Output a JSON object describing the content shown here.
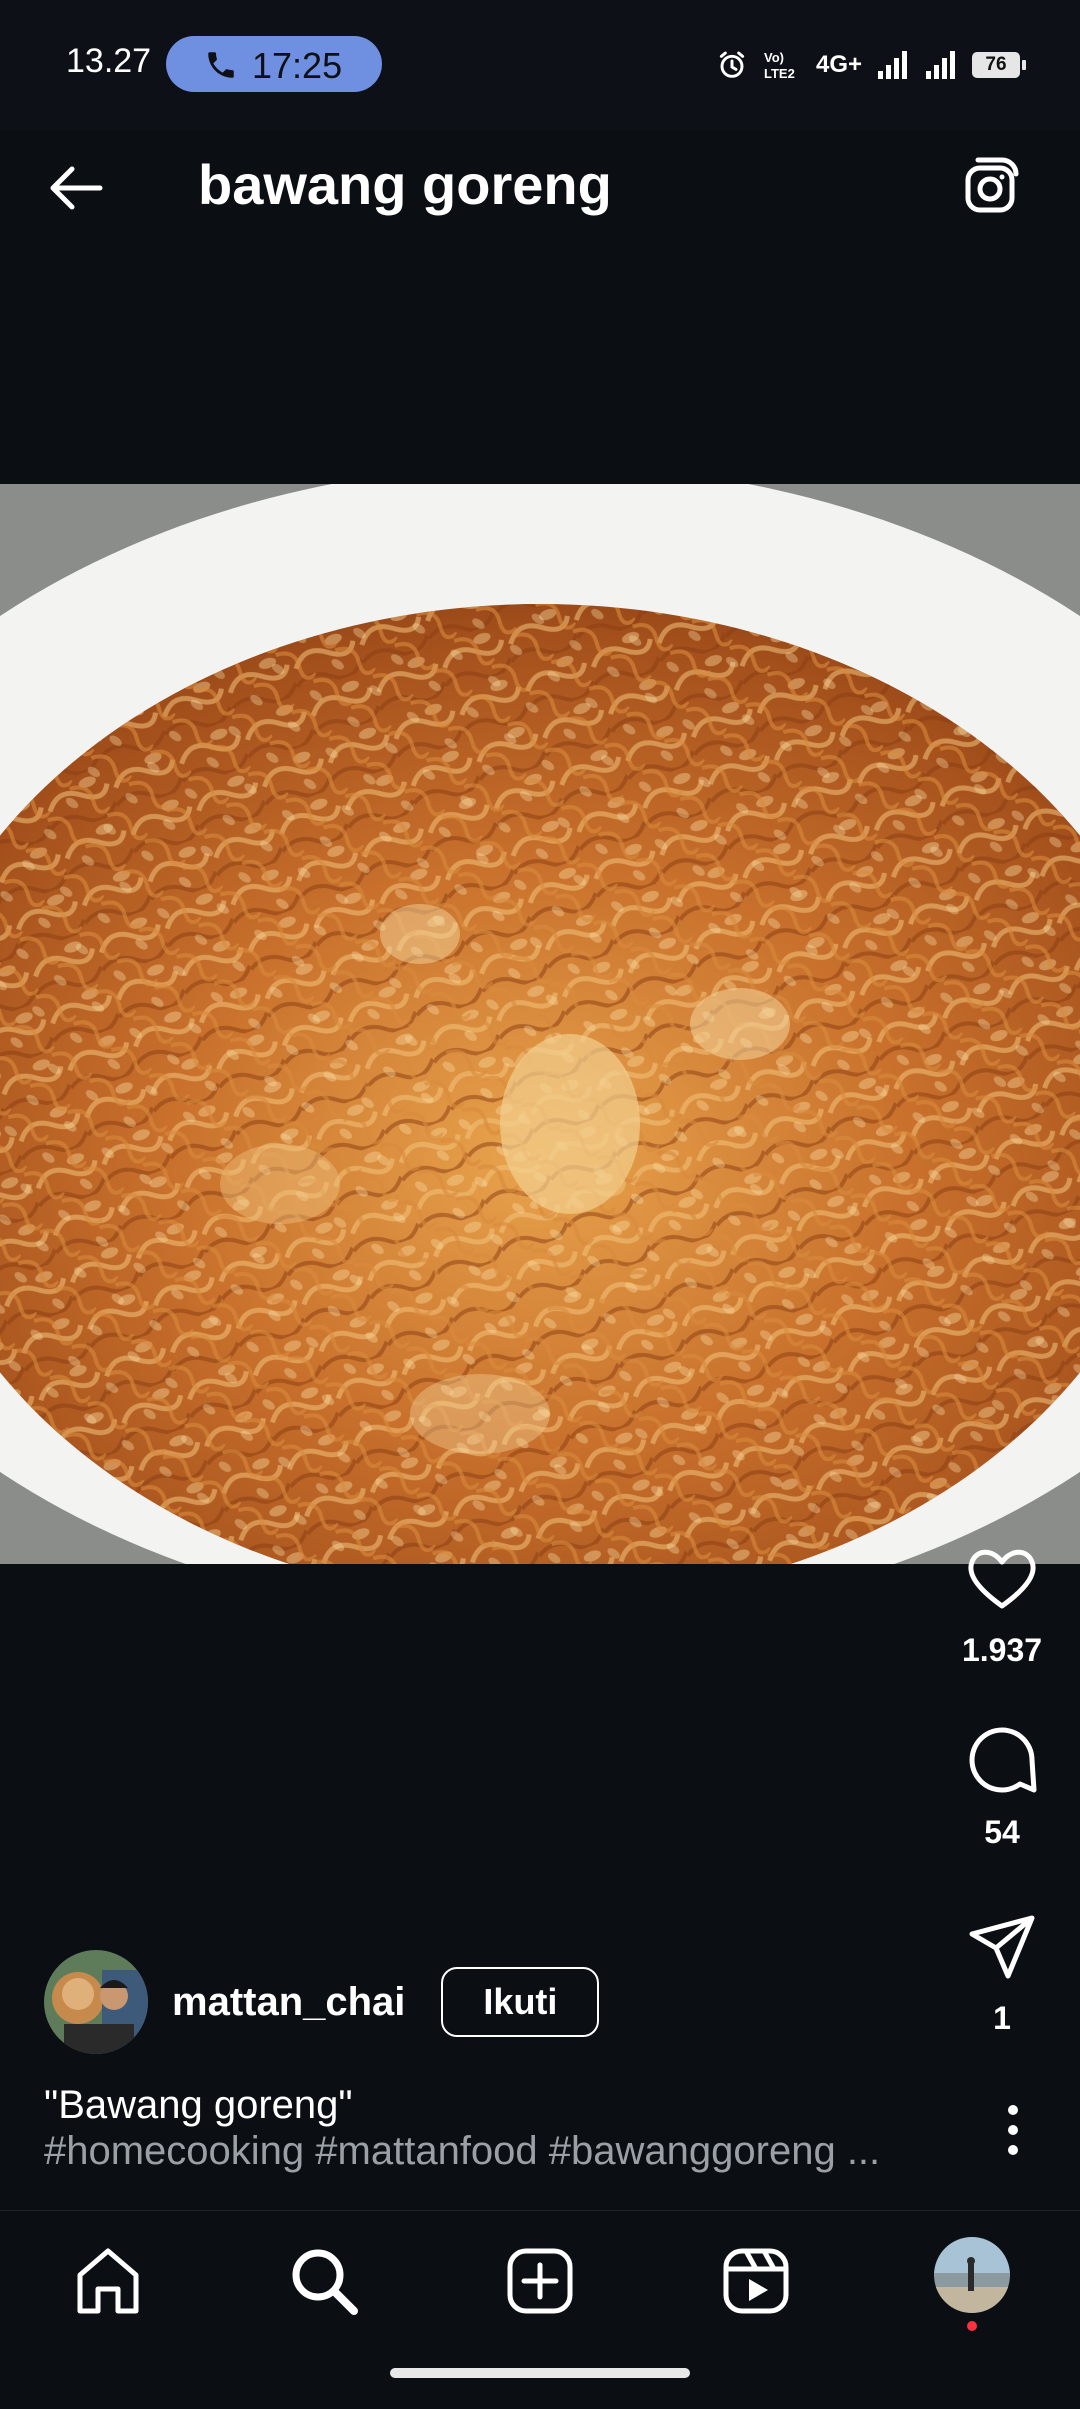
{
  "status_bar": {
    "time": "13.27",
    "call_timer": "17:25",
    "network": "4G+",
    "volte": "VoLTE2",
    "battery": "76"
  },
  "header": {
    "title": "bawang goreng"
  },
  "actions": {
    "likes": "1.937",
    "comments": "54",
    "shares": "1"
  },
  "author": {
    "username": "mattan_chai",
    "follow_label": "Ikuti"
  },
  "caption": {
    "title": "\"Bawang goreng\"",
    "hashtags": "#homecooking #mattanfood #bawanggoreng ..."
  },
  "nav": {
    "items": [
      "home-icon",
      "search-icon",
      "add-icon",
      "reels-icon",
      "profile-avatar"
    ]
  },
  "colors": {
    "background": "#0b0f14",
    "call_pill": "#6f8fe0",
    "hashtag": "#9aa0a6",
    "notification_dot": "#ff3040"
  }
}
